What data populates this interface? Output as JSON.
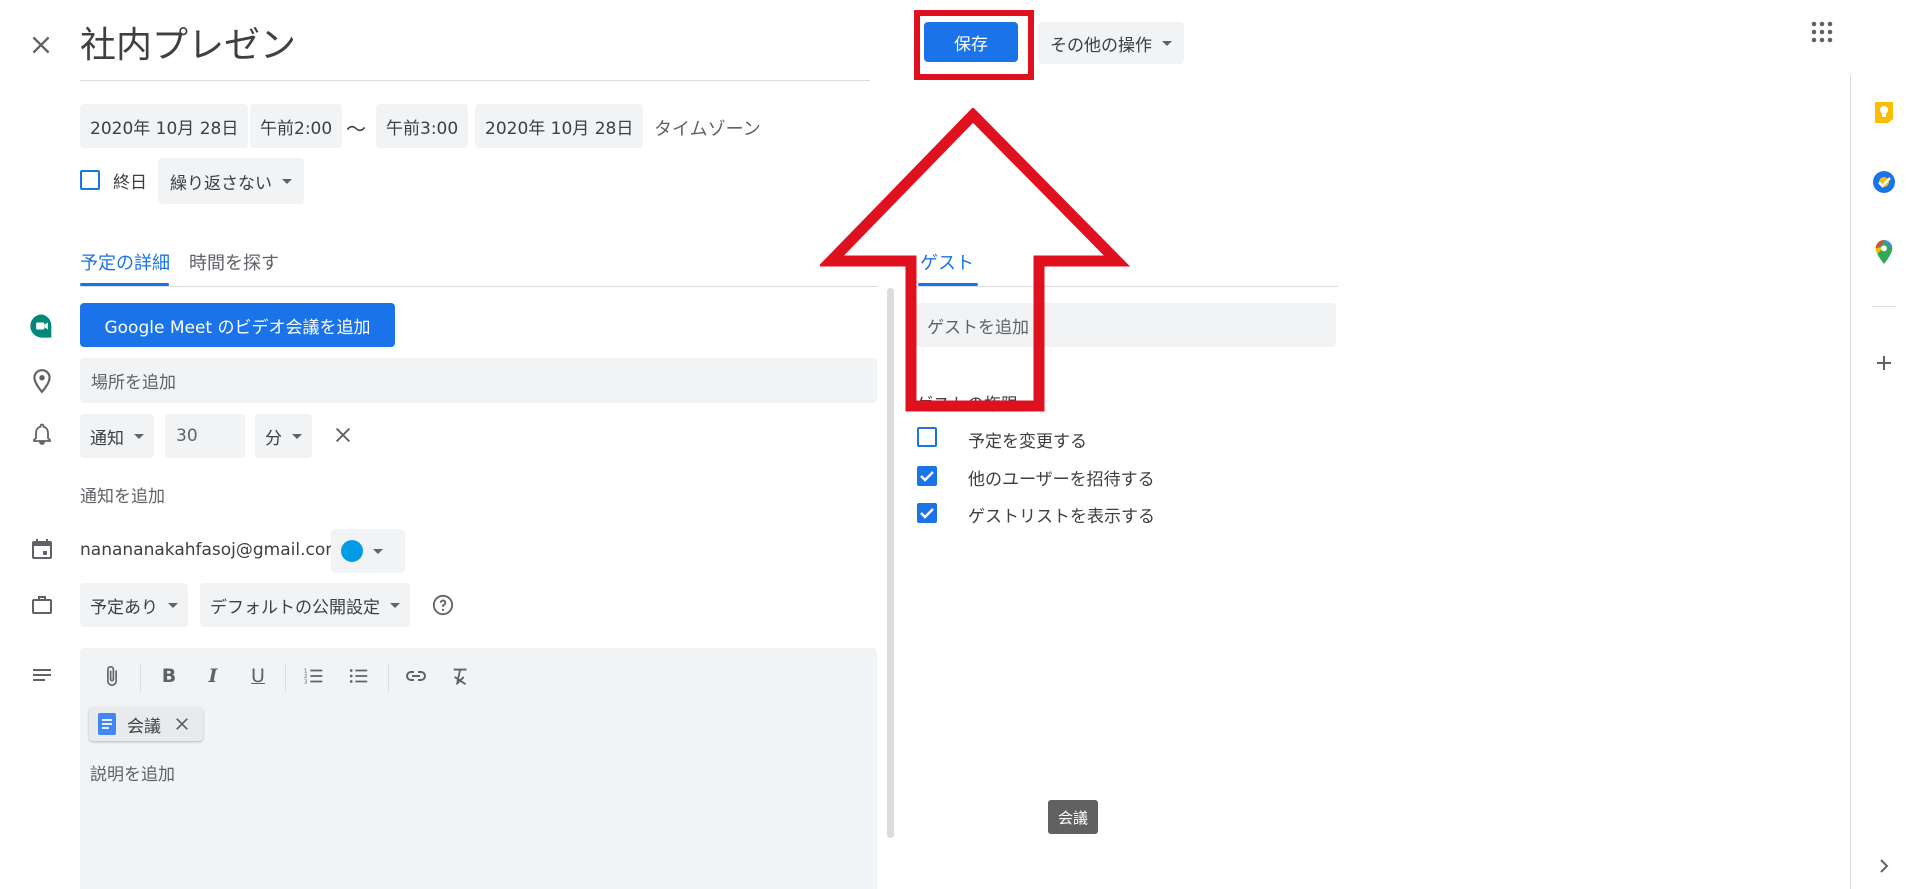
{
  "header": {
    "title": "社内プレゼン",
    "save_label": "保存",
    "more_actions_label": "その他の操作"
  },
  "datetime": {
    "start_date": "2020年 10月 28日",
    "start_time": "午前2:00",
    "separator": "〜",
    "end_time": "午前3:00",
    "end_date": "2020年 10月 28日",
    "timezone_label": "タイムゾーン",
    "all_day_label": "終日",
    "repeat_label": "繰り返さない"
  },
  "tabs": {
    "details": "予定の詳細",
    "find_time": "時間を探す",
    "guests": "ゲスト"
  },
  "details": {
    "meet_button": "Google Meet のビデオ会議を追加",
    "location_placeholder": "場所を追加",
    "notification_type": "通知",
    "notification_value": "30",
    "notification_unit": "分",
    "add_notification": "通知を追加",
    "calendar_owner": "nanananakahfasoj@gmail.com",
    "calendar_color": "#039be5",
    "busy_status": "予定あり",
    "visibility": "デフォルトの公開設定",
    "attachment_name": "会議",
    "description_placeholder": "説明を追加",
    "tooltip": "会議"
  },
  "guests": {
    "add_placeholder": "ゲストを追加",
    "permissions_title": "ゲストの権限",
    "permissions": [
      {
        "label": "予定を変更する",
        "checked": false
      },
      {
        "label": "他のユーザーを招待する",
        "checked": true
      },
      {
        "label": "ゲストリストを表示する",
        "checked": true
      }
    ]
  },
  "colors": {
    "accent": "#1a73e8",
    "annotation": "#e0111f",
    "meet_green": "#00897b",
    "field_bg": "#f1f3f4"
  },
  "icons": [
    "close-icon",
    "apps-grid-icon",
    "meet-icon",
    "location-pin-icon",
    "bell-icon",
    "calendar-icon",
    "briefcase-icon",
    "description-icon",
    "attachment-icon",
    "bold-icon",
    "italic-icon",
    "underline-icon",
    "numbered-list-icon",
    "bulleted-list-icon",
    "link-icon",
    "clear-format-icon",
    "doc-icon",
    "keep-icon",
    "tasks-icon",
    "maps-icon",
    "plus-icon",
    "chevron-right-icon",
    "help-icon"
  ]
}
